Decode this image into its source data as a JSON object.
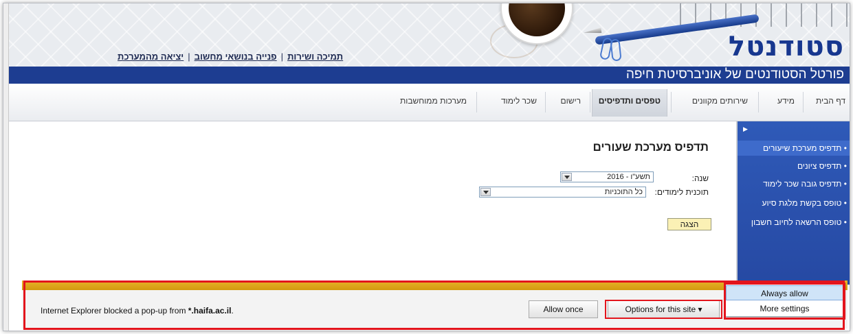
{
  "header": {
    "logo": "סטודנטל",
    "subtitle": "פורטל הסטודנטים של אוניברסיטת חיפה",
    "links": [
      "תמיכה ושירות",
      "פנייה בנושאי מחשוב",
      "יציאה מהמערכת"
    ],
    "link_separator": "|"
  },
  "nav": {
    "items": [
      "דף הבית",
      "מידע",
      "שירותים מקוונים",
      "טפסים ותדפיסים",
      "רישום",
      "שכר לימוד",
      "מערכות ממוחשבות"
    ],
    "active": "טפסים ותדפיסים"
  },
  "sidebar": {
    "items": [
      "תדפיס מערכת שיעורים",
      "תדפיס ציונים",
      "תדפיס גובה שכר לימוד",
      "טופס בקשת מלגת סיוע",
      "טופס הרשאה לחיוב חשבון"
    ],
    "selected": "תדפיס מערכת שיעורים"
  },
  "form": {
    "title": "תדפיס מערכת שעורים",
    "year_label": "שנה:",
    "year_value": "תשע\"ו - 2016",
    "program_label": "תוכנית לימודים:",
    "program_value": "כל התוכניות",
    "submit_label": "הצגה"
  },
  "popup_bar": {
    "message_prefix": "Internet Explorer blocked a pop-up from ",
    "domain": "*.haifa.ac.il",
    "message_suffix": ".",
    "allow_once": "Allow once",
    "options": "Options for this site",
    "options_caret": "▾"
  },
  "options_menu": {
    "items": [
      "Always allow",
      "More settings"
    ],
    "highlighted": "Always allow"
  },
  "colors": {
    "brand_blue": "#1d3d91",
    "sidebar_blue": "#2f5ab8",
    "notification_yellow": "#e8b32a",
    "highlight_red": "#e3141c"
  }
}
